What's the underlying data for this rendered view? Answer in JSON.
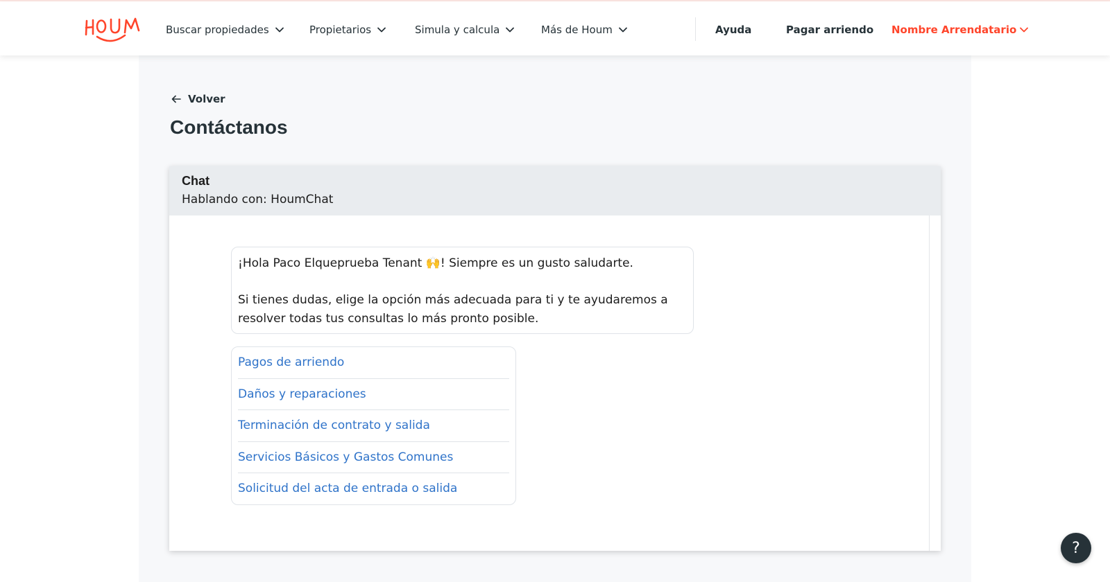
{
  "brand": {
    "logo_text": "HOUM",
    "accent_color": "#ff452b",
    "text_color": "#263238"
  },
  "nav": {
    "items": [
      {
        "label": "Buscar propiedades",
        "icon": "chevron-down-icon"
      },
      {
        "label": "Propietarios",
        "icon": "chevron-down-icon"
      },
      {
        "label": "Simula y calcula",
        "icon": "chevron-down-icon"
      },
      {
        "label": "Más de Houm",
        "icon": "chevron-down-icon"
      }
    ],
    "help_label": "Ayuda",
    "pay_label": "Pagar arriendo",
    "user_label": "Nombre Arrendatario"
  },
  "page": {
    "back_label": "Volver",
    "back_icon": "arrow-left-icon",
    "title": "Contáctanos"
  },
  "chat": {
    "title": "Chat",
    "subtitle": "Hablando con: HoumChat",
    "greeting": "¡Hola Paco Elqueprueba Tenant 🙌! Siempre es un gusto saludarte.",
    "message": "Si tienes dudas, elige la opción más adecuada para ti y te ayudaremos a resolver todas tus consultas lo más pronto posible.",
    "options": [
      "Pagos de arriendo",
      "Daños y reparaciones",
      "Terminación de contrato y salida",
      "Servicios Básicos y Gastos Comunes",
      "Solicitud del acta de entrada o salida"
    ],
    "link_color": "#2f73c9"
  },
  "help_fab": {
    "label": "?",
    "icon": "question-icon"
  }
}
